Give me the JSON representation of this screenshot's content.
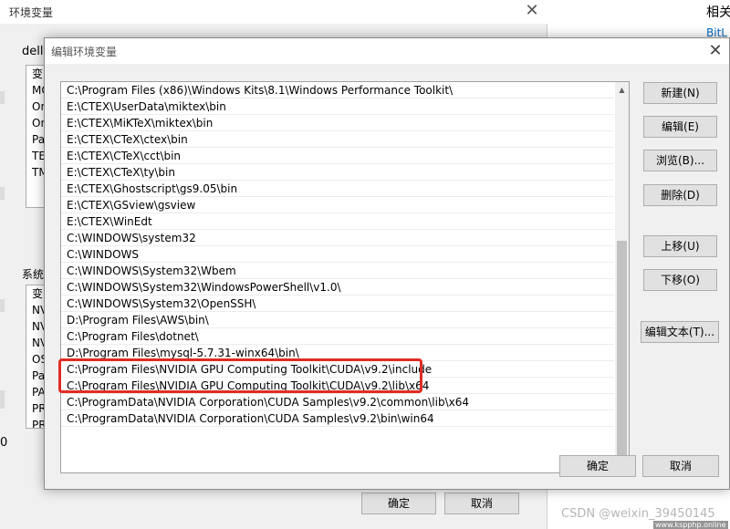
{
  "background_window": {
    "related_label": "相关",
    "bitlocker_link": "BitL",
    "dialog_title": "环境变量",
    "user_vars_label": "dell",
    "user_list_items": [
      "变",
      "MO",
      "On",
      "On",
      "Pa",
      "TE",
      "TM"
    ],
    "system_vars_label": "系统",
    "system_list_items": [
      "变",
      "NV",
      "NV",
      "NV",
      "OS",
      "Pa",
      "PA",
      "PR",
      "PR"
    ],
    "ok_label": "确定",
    "cancel_label": "取消",
    "left_edge_text": "0"
  },
  "dialog": {
    "title": "编辑环境变量",
    "path_entries": [
      "C:\\Program Files (x86)\\Windows Kits\\8.1\\Windows Performance Toolkit\\",
      "E:\\CTEX\\UserData\\miktex\\bin",
      "E:\\CTEX\\MiKTeX\\miktex\\bin",
      "E:\\CTEX\\CTeX\\ctex\\bin",
      "E:\\CTEX\\CTeX\\cct\\bin",
      "E:\\CTEX\\CTeX\\ty\\bin",
      "E:\\CTEX\\Ghostscript\\gs9.05\\bin",
      "E:\\CTEX\\GSview\\gsview",
      "E:\\CTEX\\WinEdt",
      "C:\\WINDOWS\\system32",
      "C:\\WINDOWS",
      "C:\\WINDOWS\\System32\\Wbem",
      "C:\\WINDOWS\\System32\\WindowsPowerShell\\v1.0\\",
      "C:\\WINDOWS\\System32\\OpenSSH\\",
      "D:\\Program Files\\AWS\\bin\\",
      "C:\\Program Files\\dotnet\\",
      "D:\\Program Files\\mysql-5.7.31-winx64\\bin\\",
      "C:\\Program Files\\NVIDIA GPU Computing Toolkit\\CUDA\\v9.2\\include",
      "C:\\Program Files\\NVIDIA GPU Computing Toolkit\\CUDA\\v9.2\\lib\\x64",
      "C:\\ProgramData\\NVIDIA Corporation\\CUDA Samples\\v9.2\\common\\lib\\x64",
      "C:\\ProgramData\\NVIDIA Corporation\\CUDA Samples\\v9.2\\bin\\win64"
    ],
    "buttons": {
      "new": "新建(N)",
      "edit": "编辑(E)",
      "browse": "浏览(B)...",
      "delete": "删除(D)",
      "move_up": "上移(U)",
      "move_down": "下移(O)",
      "edit_text": "编辑文本(T)...",
      "ok": "确定",
      "cancel": "取消"
    },
    "highlight_color": "#e12c25"
  },
  "watermark": {
    "text": "CSDN @weixin_39450145",
    "site": "www.kspphp.online"
  }
}
